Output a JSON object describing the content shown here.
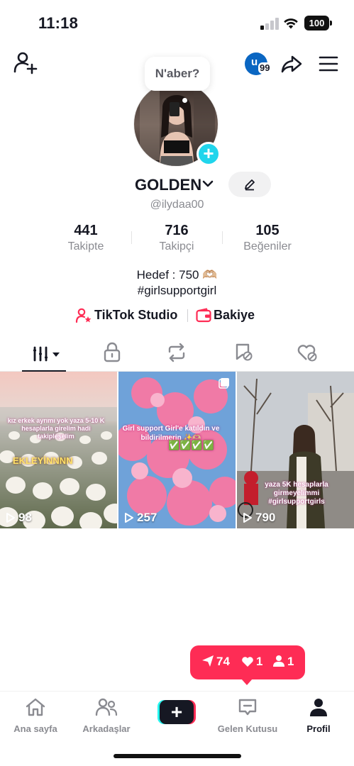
{
  "status_bar": {
    "time": "11:18",
    "battery": "100"
  },
  "top_nav": {
    "notification_letter": "u",
    "notification_count": "99"
  },
  "profile": {
    "bubble_text": "N'aber?",
    "display_name": "GOLDEN",
    "username": "@ilydaa00",
    "stats": [
      {
        "value": "441",
        "label": "Takipte"
      },
      {
        "value": "716",
        "label": "Takipçi"
      },
      {
        "value": "105",
        "label": "Beğeniler"
      }
    ],
    "bio_line1": "Hedef : 750",
    "bio_emoji": "🫶🏼",
    "bio_line2": "#girlsupportgirl",
    "studio_label": "TikTok Studio",
    "wallet_label": "Bakiye"
  },
  "tabs": [
    "videos-icon",
    "lock-icon",
    "repost-icon",
    "favorites-icon",
    "liked-icon"
  ],
  "videos": [
    {
      "views": "98",
      "caption": "kız erkek ayrımı yok yaza 5-10 K hesaplarla girelim hadi takipleşelim",
      "overlay": "EKLEYİNNNN"
    },
    {
      "views": "257",
      "caption": "Girl support Girl'e katıldın ve bildirilmerin ✨🫶🏼",
      "overlay": "✅✅✅✅"
    },
    {
      "views": "790",
      "caption": "yaza 5K hesaplarla girmeyelimmi #girlsupportgirls",
      "overlay": ""
    }
  ],
  "activity": {
    "followers": "74",
    "likes": "1",
    "friends": "1"
  },
  "bottom_nav": {
    "home": "Ana sayfa",
    "friends": "Arkadaşlar",
    "inbox": "Gelen Kutusu",
    "profile": "Profil"
  },
  "colors": {
    "accent": "#fe2c55",
    "cyan": "#25f4ee",
    "text": "#161823",
    "muted": "#8a8b91"
  }
}
